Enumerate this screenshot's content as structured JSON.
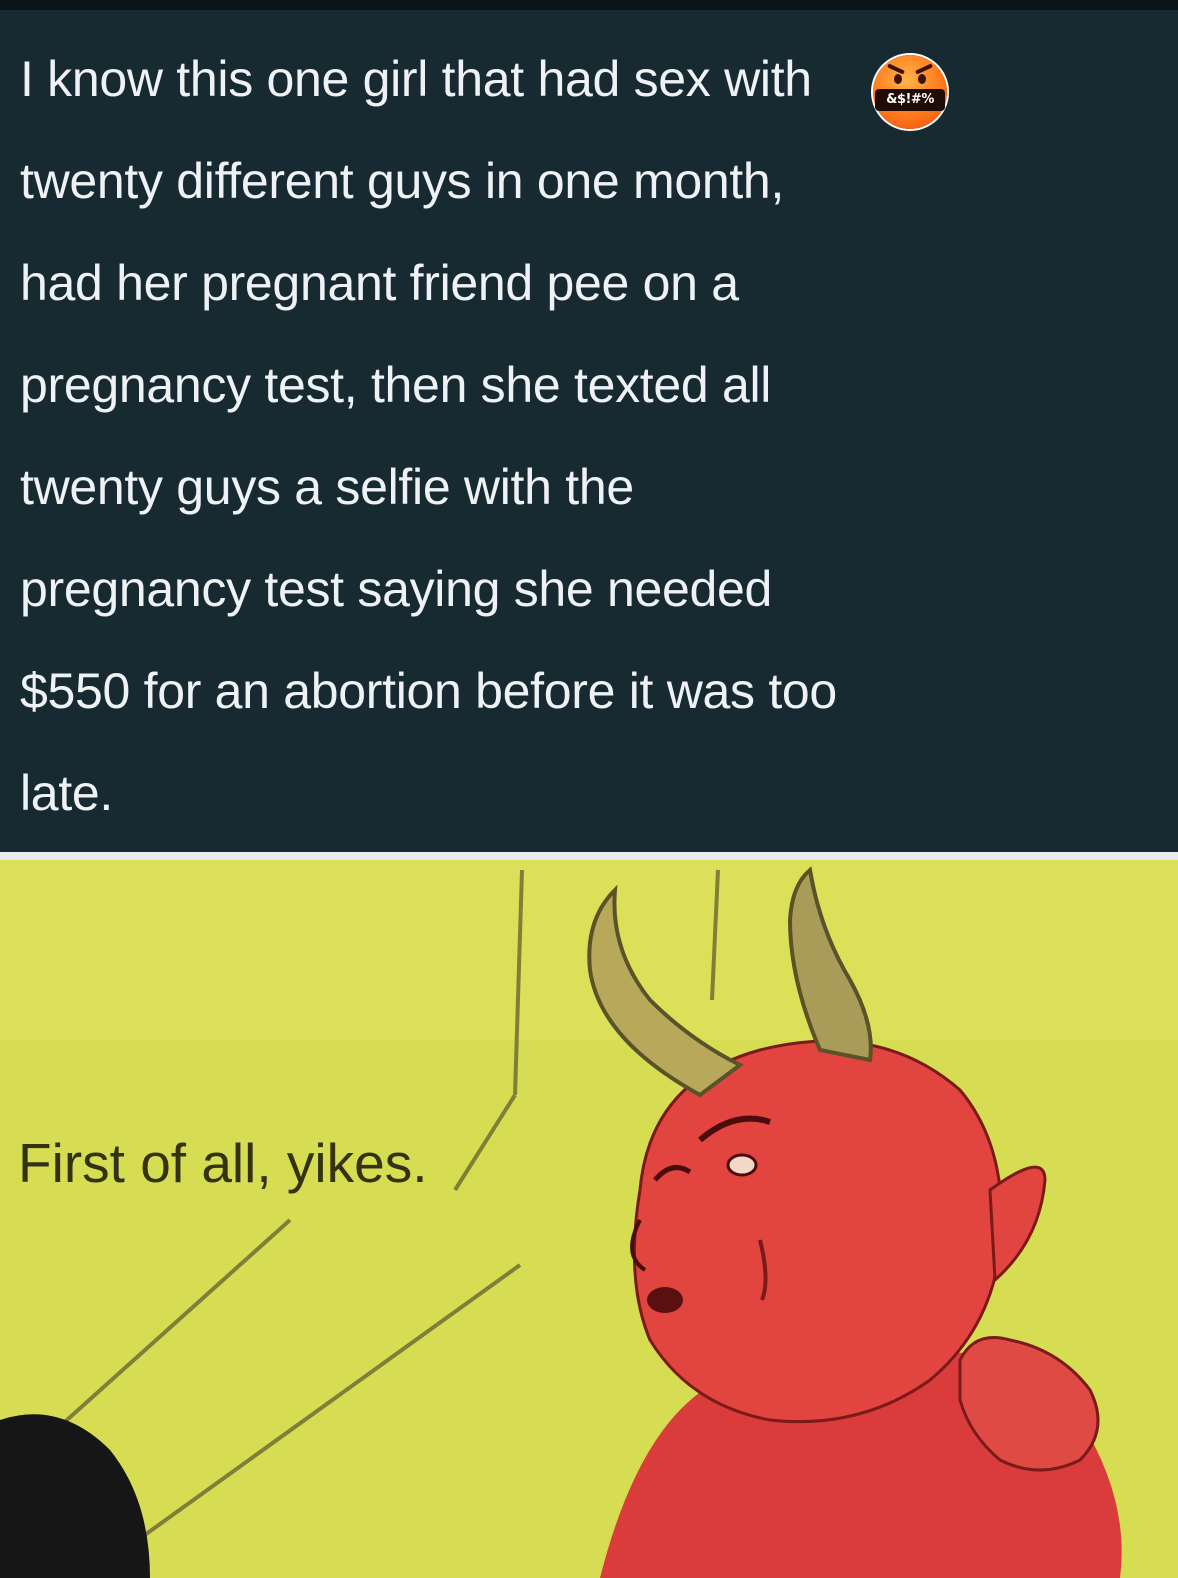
{
  "tweet": {
    "lines": [
      "I know this one girl that had sex with",
      "twenty different guys in one month,",
      "had her pregnant friend pee on a",
      "pregnancy test, then she texted all",
      "twenty guys a selfie with the",
      "pregnancy test saying she needed",
      "$550 for an abortion before it was too",
      "late."
    ],
    "censor_emoji": {
      "icon": "cursing-face-emoji",
      "symbols": "&$!#%"
    },
    "colors": {
      "background": "#182a31",
      "text": "#eef2f4"
    }
  },
  "meme": {
    "caption": "First of all, yikes.",
    "illustration": "red-devil-with-horns",
    "colors": {
      "background": "#d6dd52",
      "devil": "#e0433f",
      "horns": "#6b6a38"
    }
  }
}
